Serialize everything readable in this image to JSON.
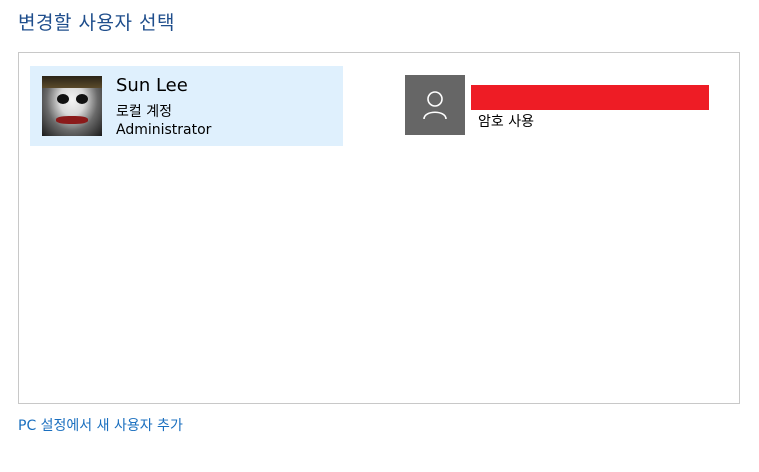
{
  "header": {
    "title": "변경할 사용자 선택"
  },
  "users": [
    {
      "name": "Sun Lee",
      "account_type": "로컬 계정",
      "role": "Administrator",
      "avatar": "photo",
      "selected": true
    },
    {
      "name": "",
      "status": "암호 사용",
      "avatar": "generic-user-icon",
      "selected": false
    }
  ],
  "footer": {
    "add_user_link": "PC 설정에서 새 사용자 추가"
  },
  "colors": {
    "title": "#1f4e8c",
    "selected_tile": "#dff0fd",
    "generic_avatar": "#666666",
    "redaction": "#ee1c25",
    "link": "#1a6fbf"
  }
}
